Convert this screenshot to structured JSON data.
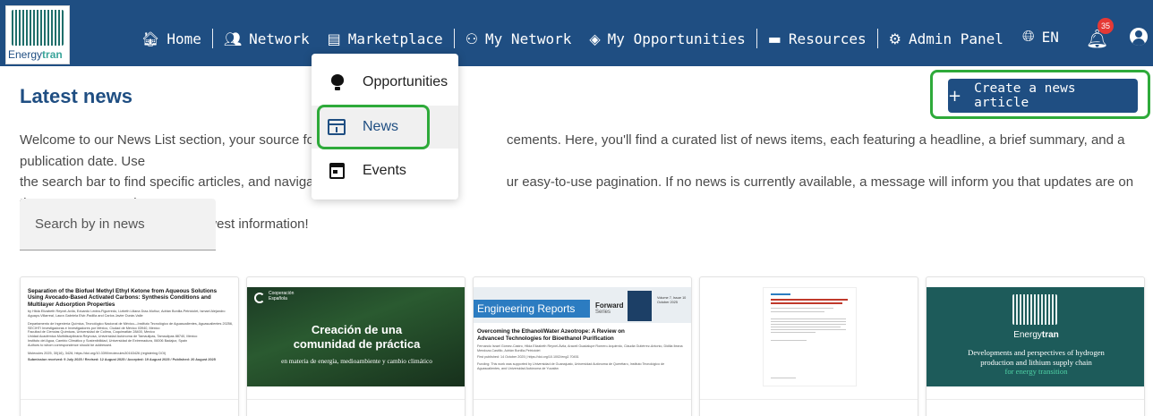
{
  "brand": {
    "name_part1": "Energy",
    "name_part2": "tran"
  },
  "nav": {
    "home": "Home",
    "network": "Network",
    "marketplace": "Marketplace",
    "my_network": "My Network",
    "my_opportunities": "My Opportunities",
    "resources": "Resources",
    "admin_panel": "Admin Panel",
    "language": "EN",
    "notification_count": "35"
  },
  "dropdown": {
    "items": [
      {
        "label": "Opportunities",
        "icon": "lightbulb-icon"
      },
      {
        "label": "News",
        "icon": "newspaper-icon",
        "active": true
      },
      {
        "label": "Events",
        "icon": "calendar-icon"
      }
    ]
  },
  "page": {
    "title": "Latest news",
    "intro": "Welcome to our News List section, your source for the latest updates and announcements. Here, you'll find a curated list of news items, each featuring a headline, a brief summary, and a publication date. Use the search bar to find specific articles, and navigate through pages with our easy-to-use pagination. If no news is currently available, a message will inform you that updates are on the way. Stay tuned and check back often for the newest information!",
    "intro_part1": "Welcome to our News List section, your source for the",
    "intro_part2": "cements. Here, you'll find a curated list of news items, each featuring a headline, a brief summary, and a publication date. Use",
    "intro_part3": "the search bar to find specific articles, and navigate th",
    "intro_part4": "ur easy-to-use pagination. If no news is currently available, a message will inform you that updates are on the way. Stay tuned",
    "intro_part5": "and check back often for the newest information!",
    "create_button": "Create a news article",
    "search_placeholder": "Search by in news"
  },
  "cards": {
    "c1": {
      "title": "Separation of the Biofuel Methyl Ethyl Ketone from Aqueous Solutions Using Avocado-Based Activated Carbons: Synthesis Conditions and Multilayer Adsorption Properties",
      "authors": "by Hilda Elizabeth Reynel-Avila, Eduardo Ledea-Figueredo, Lizbeth Liliana Díaz-Muñoz, Adrián Bonilla-Petriciolet, Ismael Alejandro Aguayo-Villarreal, Laura Gabriela Elvir-Padilla and Carlos Javier Durán-Valle",
      "aff1": "Departamento de Ingeniería Química, Tecnológico Nacional de México—Instituto Tecnológico de Aguascalientes, Aguascalientes 20256, Mexico",
      "aff2": "SECIHTI Investigadoras e Investigadores por México, Ciudad de México 03940, Mexico",
      "aff3": "Facultad de Ciencias Químicas, Universidad de Colima, Coquimatlán 28400, Mexico",
      "aff4": "Unidad Académica Multidisciplinaria Reynosa, Universidad Autónoma de Tamaulipas, Tamaulipas 88740, Mexico",
      "aff5": "Instituto del Agua, Cambio Climático y Sostenibilidad, Universidad de Extremadura, 06006 Badajoz, Spain",
      "aff6": "Authors to whom correspondence should be addressed.",
      "journal": "Molecules 2025, 30(16), 3426; https://doi.org/10.3390/molecules30163426 (registering DOI)",
      "dates": "Submission received: 9 July 2025 / Revised: 12 August 2025 / Accepted: 19 August 2025 / Published: 20 August 2025"
    },
    "c2": {
      "org1": "Cooperación",
      "org2": "Española",
      "headline1": "Creación de una",
      "headline2": "comunidad de práctica",
      "sub": "en materia de energía, medioambiente y cambio climático"
    },
    "c3": {
      "journal": "Engineering Reports",
      "series1": "Forward",
      "series2": "Series",
      "volume": "Volume 7, Issue 10",
      "date": "October 2025",
      "title": "Overcoming the Ethanol/Water Azeotrope: A Review on Advanced Technologies for Bioethanol Purification",
      "authors": "Fernando Israel Gómez-Castro, Hilda Elizabeth Reynel-Ávila, Araceli Guadalupe Romero-Izquierdo, Claudia Gutiérrez-Antonio, Didilia Ileana Mendoza-Castillo, Adrián Bonilla-Petriciolet",
      "published": "First published: 14 October 2025 | https://doi.org/10.1002/eng2.70451",
      "funding": "Funding: This work was supported by Universidad de Guanajuato, Universidad Autónoma de Querétaro, Instituto Tecnológico de Aguascalientes, and Universidad Autónoma de Yucatán"
    },
    "c5": {
      "brand1": "Energy",
      "brand2": "tran",
      "line1": "Developments and perspectives of hydrogen",
      "line2": "production and lithium supply chain",
      "line3": "for energy transition"
    }
  },
  "colors": {
    "navbar": "#1f4e82",
    "highlight": "#2eaa3a",
    "badge": "#e53935"
  }
}
